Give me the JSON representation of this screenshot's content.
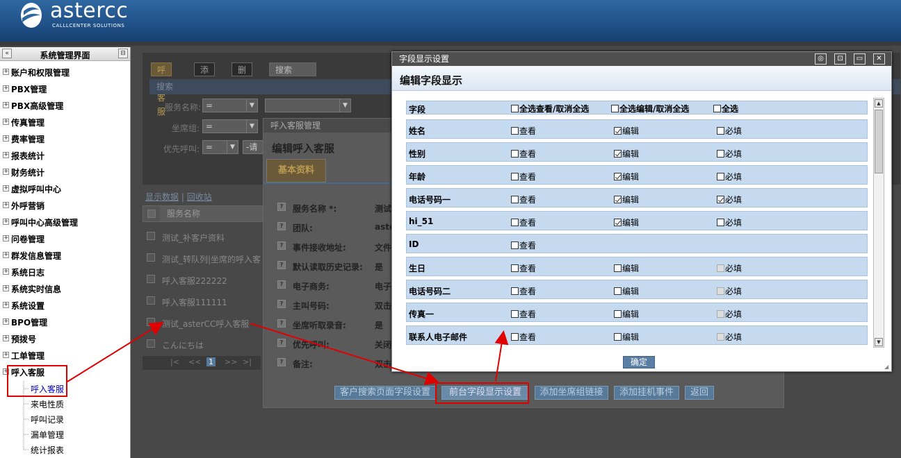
{
  "brand": {
    "name": "astercc",
    "tagline": "CALLLCENTER SOLUTIONS"
  },
  "sidebar": {
    "title": "系统管理界面",
    "collapse_icon": "«",
    "pin_icon": "⊟",
    "expander": "+",
    "items": [
      {
        "label": "账户和权限管理"
      },
      {
        "label": "PBX管理"
      },
      {
        "label": "PBX高级管理"
      },
      {
        "label": "传真管理"
      },
      {
        "label": "费率管理"
      },
      {
        "label": "报表统计"
      },
      {
        "label": "财务统计"
      },
      {
        "label": "虚拟呼叫中心"
      },
      {
        "label": "外呼营销"
      },
      {
        "label": "呼叫中心高级管理"
      },
      {
        "label": "问卷管理"
      },
      {
        "label": "群发信息管理"
      },
      {
        "label": "系统日志"
      },
      {
        "label": "系统实时信息"
      },
      {
        "label": "系统设置"
      },
      {
        "label": "BPO管理"
      },
      {
        "label": "预拨号"
      },
      {
        "label": "工单管理"
      },
      {
        "label": "呼入客服"
      }
    ],
    "children": [
      {
        "label": "呼入客服",
        "active": true
      },
      {
        "label": "来电性质"
      },
      {
        "label": "呼叫记录"
      },
      {
        "label": "漏单管理"
      },
      {
        "label": "统计报表"
      }
    ]
  },
  "main": {
    "tabs": [
      "呼入客服",
      "添加",
      "删除",
      "搜索"
    ],
    "search_title": "搜索",
    "form": {
      "service_name_label": "服务名称:",
      "group_label": "坐席组:",
      "priority_label": "优先呼叫:",
      "op": "=",
      "placeholder_dash": "-请"
    },
    "links": {
      "show_data": "显示数据",
      "recycle": "回收站"
    },
    "list_header": "服务名称",
    "list_rows": [
      "测试_补客户资料",
      "测试_转队列|坐席的呼入客",
      "呼入客服222222",
      "呼入客服111111",
      "测试_asterCC呼入客服",
      "こんにちは"
    ],
    "pager": [
      "|<",
      "<<",
      "1",
      ">>",
      ">|"
    ]
  },
  "back_dialog": {
    "title": "呼入客服管理",
    "heading": "编辑呼入客服",
    "tab": "基本资料",
    "rows": [
      {
        "k": "服务名称 *:",
        "v": "测试"
      },
      {
        "k": "团队:",
        "v": "aste"
      },
      {
        "k": "事件接收地址:",
        "v": "文件"
      },
      {
        "k": "默认读取历史记录:",
        "v": "是"
      },
      {
        "k": "电子商务:",
        "v": "电子"
      },
      {
        "k": "主叫号码:",
        "v": "双击"
      },
      {
        "k": "坐席听取录音:",
        "v": "是"
      },
      {
        "k": "优先呼叫:",
        "v": "关闭"
      },
      {
        "k": "备注:",
        "v": "双击"
      }
    ],
    "buttons": [
      "客户搜索页面字段设置",
      "前台字段显示设置",
      "添加坐席组链接",
      "添加挂机事件",
      "返回"
    ]
  },
  "field_dialog": {
    "title": "字段显示设置",
    "heading": "编辑字段显示",
    "header": {
      "field": "字段",
      "view_all": "全选查看/取消全选",
      "edit_all": "全选编辑/取消全选",
      "required_all": "全选"
    },
    "labels": {
      "view": "查看",
      "edit": "编辑",
      "required": "必填"
    },
    "rows": [
      {
        "name": "姓名",
        "view": false,
        "edit": true,
        "edit_show": true,
        "required": false,
        "req_show": true,
        "req_dis": false
      },
      {
        "name": "性别",
        "view": false,
        "edit": true,
        "edit_show": true,
        "required": false,
        "req_show": true,
        "req_dis": false
      },
      {
        "name": "年龄",
        "view": false,
        "edit": true,
        "edit_show": true,
        "required": false,
        "req_show": true,
        "req_dis": false
      },
      {
        "name": "电话号码一",
        "view": false,
        "edit": true,
        "edit_show": true,
        "required": true,
        "req_show": true,
        "req_dis": false
      },
      {
        "name": "hi_51",
        "view": false,
        "edit": true,
        "edit_show": true,
        "required": false,
        "req_show": true,
        "req_dis": false
      },
      {
        "name": "ID",
        "view": false,
        "edit": false,
        "edit_show": false,
        "required": false,
        "req_show": false,
        "req_dis": false
      },
      {
        "name": "生日",
        "view": false,
        "edit": false,
        "edit_show": true,
        "required": false,
        "req_show": true,
        "req_dis": true
      },
      {
        "name": "电话号码二",
        "view": false,
        "edit": false,
        "edit_show": true,
        "required": false,
        "req_show": true,
        "req_dis": true
      },
      {
        "name": "传真一",
        "view": false,
        "edit": false,
        "edit_show": true,
        "required": false,
        "req_show": true,
        "req_dis": true
      },
      {
        "name": "联系人电子邮件",
        "view": false,
        "edit": false,
        "edit_show": true,
        "required": false,
        "req_show": true,
        "req_dis": true
      }
    ],
    "ok_label": "确定",
    "window_icons": [
      "◎",
      "⊡",
      "▭",
      "✕"
    ]
  },
  "colors": {
    "header_bg": "#1d4d83",
    "row_bg": "#c5d9ef",
    "highlight": "#e00000",
    "ok_btn": "#5a7ea4"
  }
}
